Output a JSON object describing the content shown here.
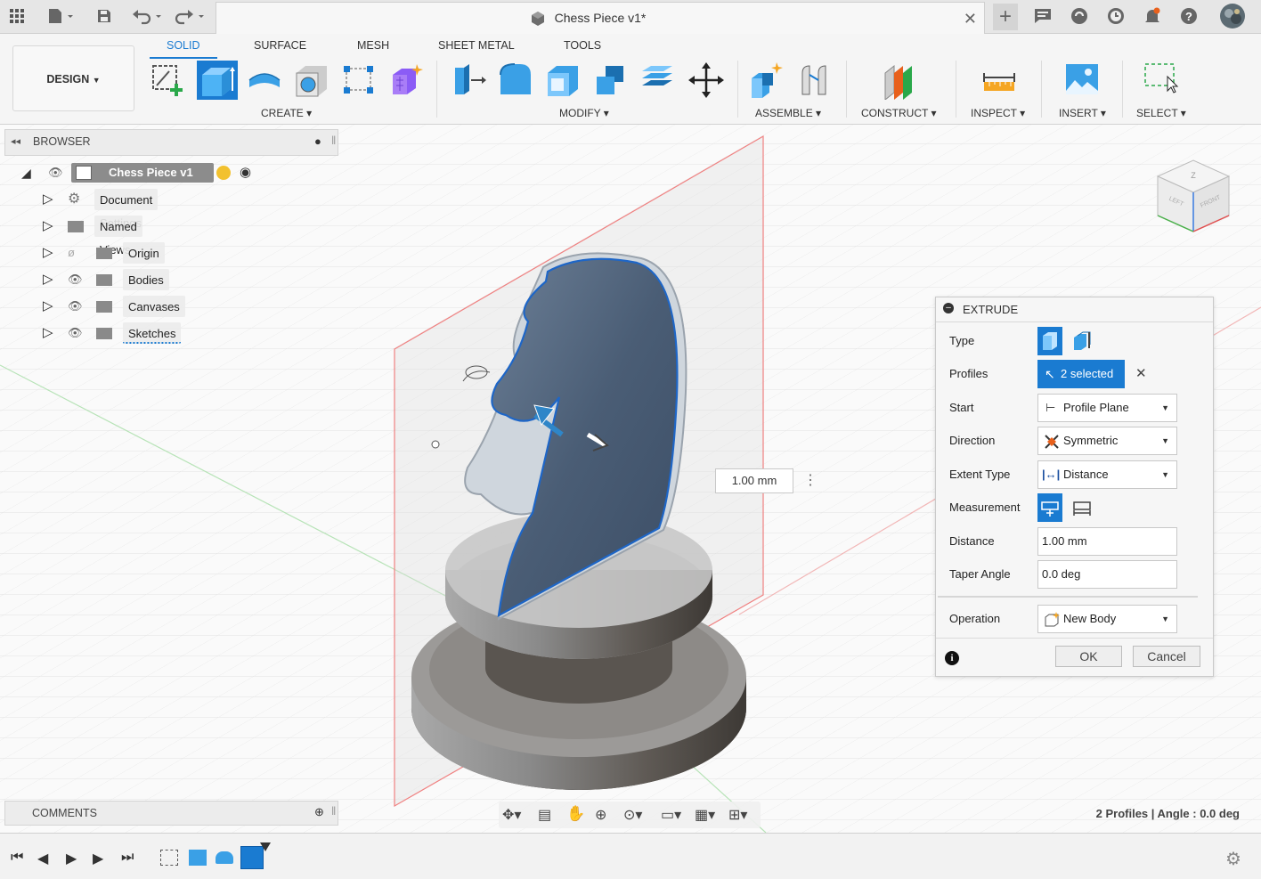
{
  "titlebar": {
    "doc_title": "Chess Piece v1*",
    "icons": [
      "grid-icon",
      "file-icon",
      "save-icon",
      "undo-icon",
      "redo-icon",
      "close-icon",
      "new-tab-icon",
      "comment-icon",
      "extension-icon",
      "clock-icon",
      "notification-icon",
      "help-icon",
      "user-avatar"
    ]
  },
  "ribbon": {
    "tabs": [
      {
        "label": "SOLID",
        "active": true
      },
      {
        "label": "SURFACE",
        "active": false
      },
      {
        "label": "MESH",
        "active": false
      },
      {
        "label": "SHEET METAL",
        "active": false
      },
      {
        "label": "TOOLS",
        "active": false
      }
    ],
    "workspace": "DESIGN",
    "groups": [
      "CREATE",
      "MODIFY",
      "ASSEMBLE",
      "CONSTRUCT",
      "INSPECT",
      "INSERT",
      "SELECT"
    ],
    "accent": "#1a7bd1"
  },
  "browser": {
    "title": "BROWSER",
    "root": "Chess Piece v1",
    "items": [
      {
        "label": "Document Settings",
        "icon": "gear-icon"
      },
      {
        "label": "Named Views",
        "icon": "folder-icon"
      },
      {
        "label": "Origin",
        "icon": "folder-icon"
      },
      {
        "label": "Bodies",
        "icon": "folder-icon"
      },
      {
        "label": "Canvases",
        "icon": "folder-icon"
      },
      {
        "label": "Sketches",
        "icon": "folder-icon"
      }
    ]
  },
  "viewport": {
    "dimension_value": "1.00 mm",
    "status": "2 Profiles | Angle : 0.0 deg",
    "viewcube": {
      "top": "Z",
      "left": "LEFT",
      "front": "FRONT"
    }
  },
  "extrude": {
    "title": "EXTRUDE",
    "rows": {
      "type": "Type",
      "profiles": "Profiles",
      "profiles_value": "2 selected",
      "start": "Start",
      "start_value": "Profile Plane",
      "direction": "Direction",
      "direction_value": "Symmetric",
      "extent": "Extent Type",
      "extent_value": "Distance",
      "measurement": "Measurement",
      "distance": "Distance",
      "distance_value": "1.00 mm",
      "taper": "Taper Angle",
      "taper_value": "0.0 deg",
      "operation": "Operation",
      "operation_value": "New Body"
    },
    "ok": "OK",
    "cancel": "Cancel"
  },
  "comments": {
    "title": "COMMENTS"
  }
}
